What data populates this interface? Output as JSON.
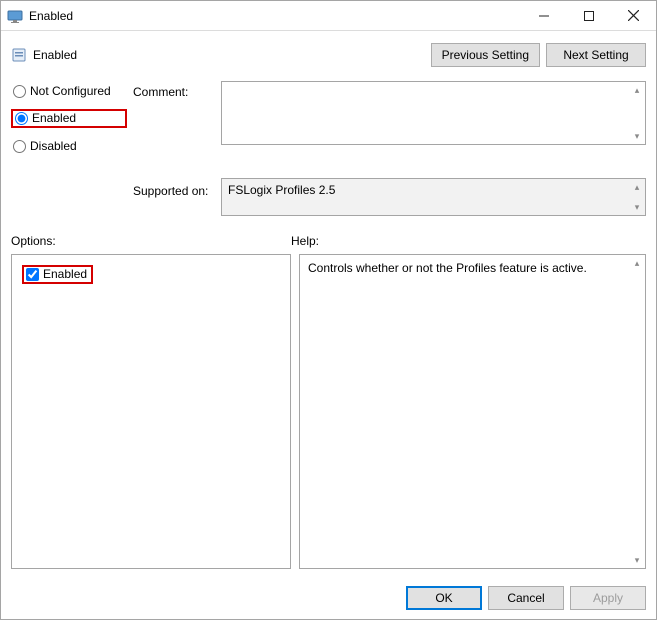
{
  "window": {
    "title": "Enabled"
  },
  "header": {
    "policy_name": "Enabled",
    "prev_btn": "Previous Setting",
    "next_btn": "Next Setting"
  },
  "state": {
    "not_configured_label": "Not Configured",
    "enabled_label": "Enabled",
    "disabled_label": "Disabled",
    "selected": "enabled"
  },
  "labels": {
    "comment": "Comment:",
    "supported_on": "Supported on:",
    "options": "Options:",
    "help": "Help:"
  },
  "fields": {
    "comment_value": "",
    "supported_value": "FSLogix Profiles 2.5"
  },
  "options": {
    "enabled_checkbox_label": "Enabled",
    "enabled_checked": true
  },
  "help": {
    "text": "Controls whether or not the Profiles feature is active."
  },
  "footer": {
    "ok": "OK",
    "cancel": "Cancel",
    "apply": "Apply"
  }
}
